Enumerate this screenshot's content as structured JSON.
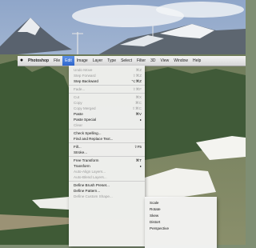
{
  "menubar": {
    "apple_icon": "apple-logo-icon",
    "items": [
      "Photoshop",
      "File",
      "Edit",
      "Image",
      "Layer",
      "Type",
      "Select",
      "Filter",
      "3D",
      "View",
      "Window",
      "Help"
    ],
    "active_index": 2,
    "active_color": "#3a73d8"
  },
  "edit_menu": {
    "items": [
      {
        "label": "Undo Move",
        "shortcut": "⌘Z",
        "disabled": true
      },
      {
        "label": "Step Forward",
        "shortcut": "⇧⌘Z",
        "disabled": true
      },
      {
        "label": "Step Backward",
        "shortcut": "⌥⌘Z",
        "disabled": false
      },
      {
        "sep": true
      },
      {
        "label": "Fade...",
        "shortcut": "⇧⌘F",
        "disabled": true
      },
      {
        "sep": true
      },
      {
        "label": "Cut",
        "shortcut": "⌘X",
        "disabled": true
      },
      {
        "label": "Copy",
        "shortcut": "⌘C",
        "disabled": true
      },
      {
        "label": "Copy Merged",
        "shortcut": "⇧⌘C",
        "disabled": true
      },
      {
        "label": "Paste",
        "shortcut": "⌘V",
        "disabled": false
      },
      {
        "label": "Paste Special",
        "shortcut": "▸",
        "disabled": false
      },
      {
        "label": "Clear",
        "shortcut": "",
        "disabled": true
      },
      {
        "sep": true
      },
      {
        "label": "Check Spelling...",
        "shortcut": "",
        "disabled": false
      },
      {
        "label": "Find and Replace Text...",
        "shortcut": "",
        "disabled": false
      },
      {
        "sep": true
      },
      {
        "label": "Fill...",
        "shortcut": "⇧F5",
        "disabled": false
      },
      {
        "label": "Stroke...",
        "shortcut": "",
        "disabled": false
      },
      {
        "sep": true
      },
      {
        "label": "Free Transform",
        "shortcut": "⌘T",
        "disabled": false
      },
      {
        "label": "Transform",
        "shortcut": "▸",
        "disabled": false
      },
      {
        "label": "Auto-Align Layers...",
        "shortcut": "",
        "disabled": true
      },
      {
        "label": "Auto-Blend Layers...",
        "shortcut": "",
        "disabled": true
      },
      {
        "sep": true
      },
      {
        "label": "Define Brush Preset...",
        "shortcut": "",
        "disabled": false
      },
      {
        "label": "Define Pattern...",
        "shortcut": "",
        "disabled": false
      },
      {
        "label": "Define Custom Shape...",
        "shortcut": "",
        "disabled": true
      }
    ]
  },
  "transform_submenu": {
    "items": [
      "Scale",
      "Rotate",
      "Skew",
      "Distort",
      "Perspective"
    ]
  }
}
